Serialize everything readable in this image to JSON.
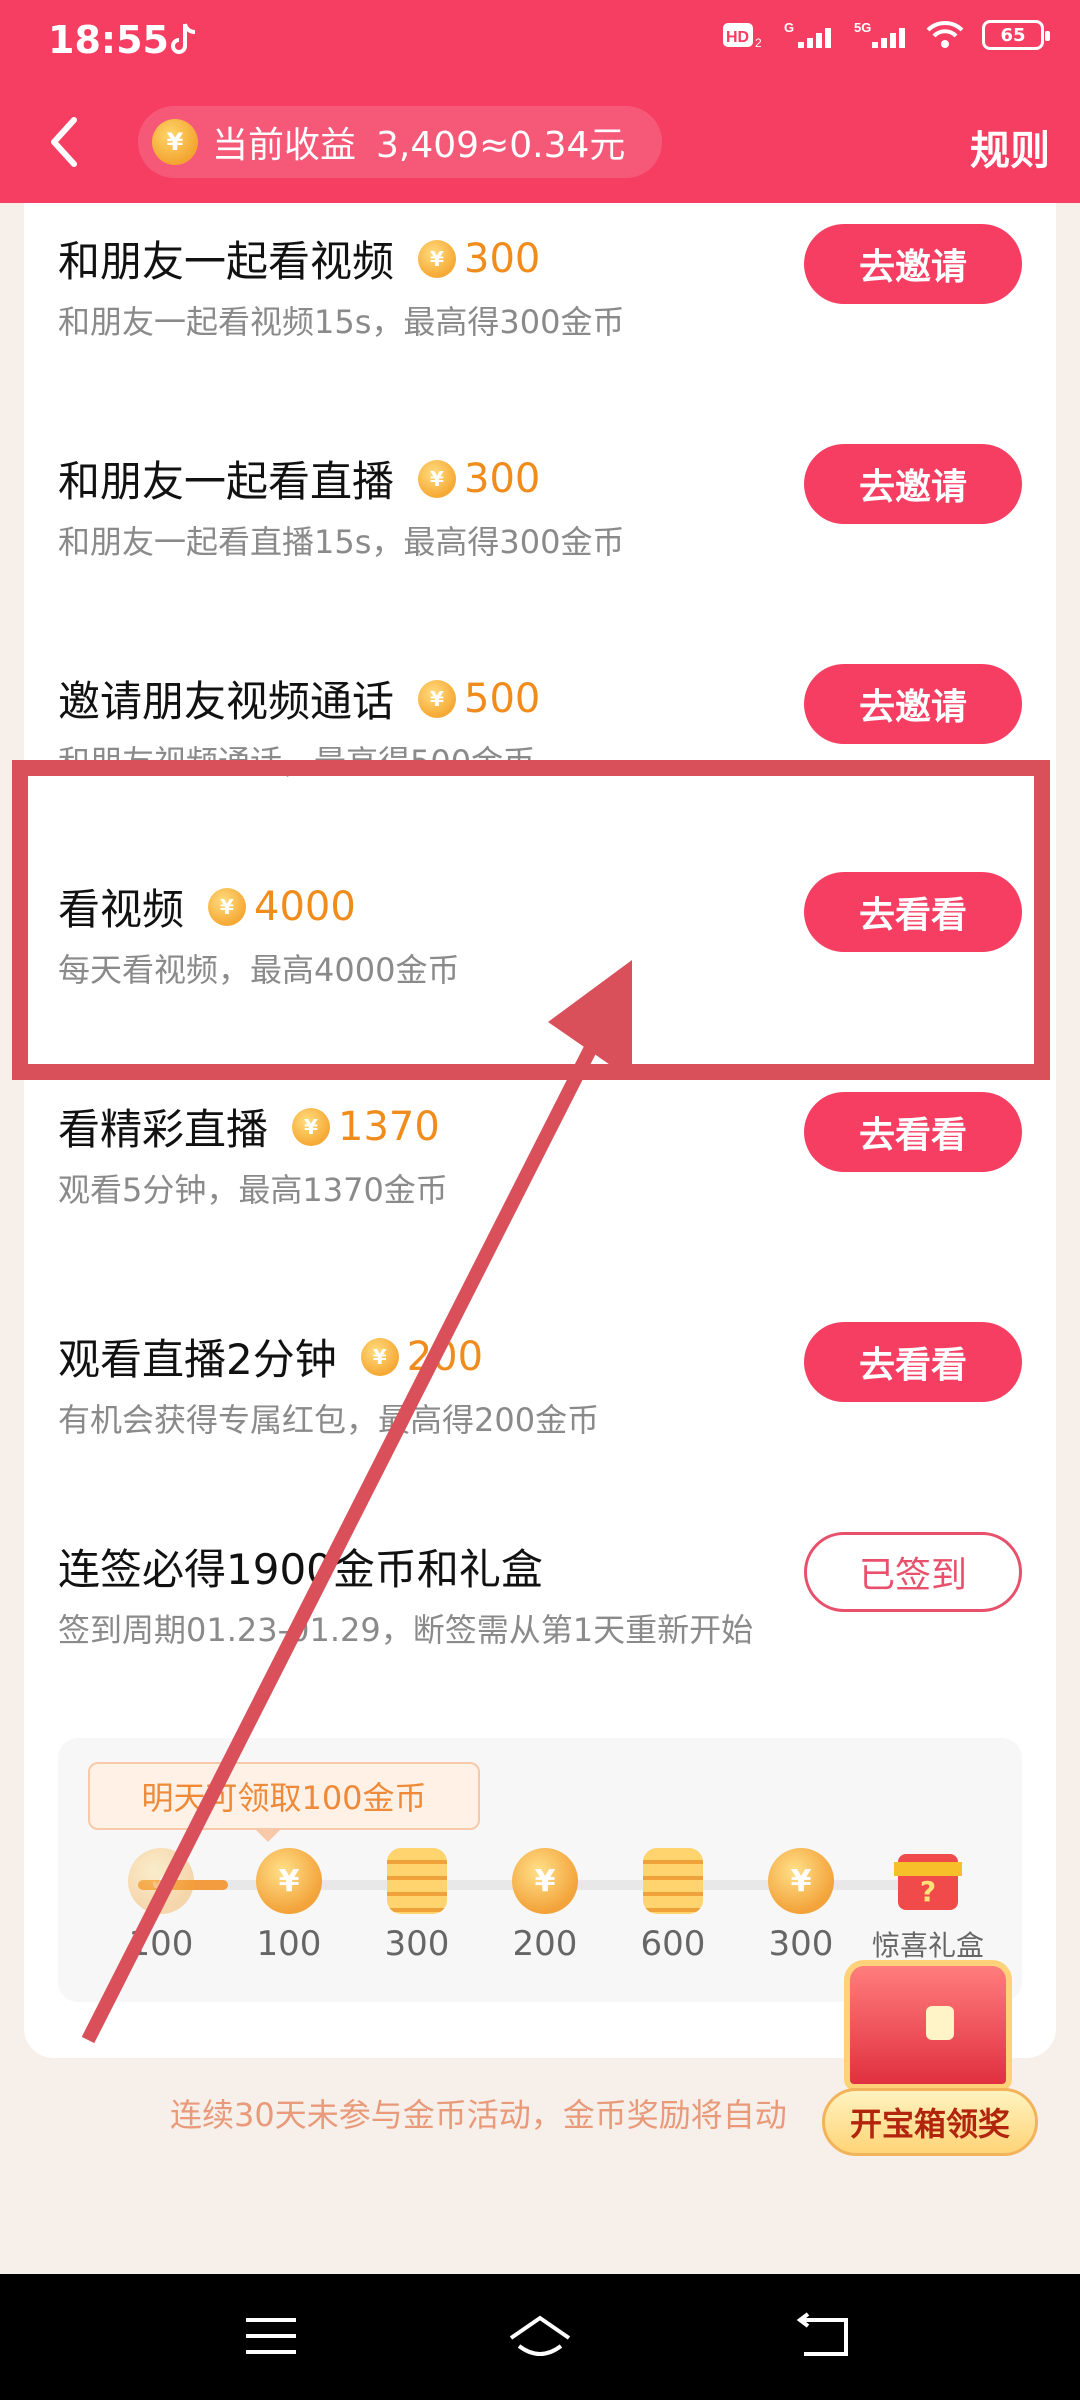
{
  "status_bar": {
    "time": "18:55",
    "battery": "65"
  },
  "header": {
    "earnings_label": "当前收益",
    "earnings_value": "3,409≈0.34元",
    "rules_label": "规则"
  },
  "tasks": [
    {
      "title": "和朋友一起看视频",
      "reward": "300",
      "desc": "和朋友一起看视频15s，最高得300金币",
      "button": "去邀请"
    },
    {
      "title": "和朋友一起看直播",
      "reward": "300",
      "desc": "和朋友一起看直播15s，最高得300金币",
      "button": "去邀请"
    },
    {
      "title": "邀请朋友视频通话",
      "reward": "500",
      "desc": "和朋友视频通话，最高得500金币",
      "button": "去邀请"
    },
    {
      "title": "看视频",
      "reward": "4000",
      "desc": "每天看视频，最高4000金币",
      "button": "去看看"
    },
    {
      "title": "看精彩直播",
      "reward": "1370",
      "desc": "观看5分钟，最高1370金币",
      "button": "去看看"
    },
    {
      "title": "观看直播2分钟",
      "reward": "200",
      "desc": "有机会获得专属红包，最高得200金币",
      "button": "去看看"
    }
  ],
  "signin": {
    "title": "连签必得1900金币和礼盒",
    "desc": "签到周期01.23-01.29，断签需从第1天重新开始",
    "button": "已签到",
    "tomorrow_tip": "明天可领取100金币",
    "days": [
      {
        "label": "100",
        "icon": "coin-icon",
        "done": true
      },
      {
        "label": "100",
        "icon": "coin-icon"
      },
      {
        "label": "300",
        "icon": "coin-stack-icon"
      },
      {
        "label": "200",
        "icon": "coin-icon"
      },
      {
        "label": "600",
        "icon": "coin-stack-icon"
      },
      {
        "label": "300",
        "icon": "coin-icon"
      },
      {
        "label": "惊喜礼盒",
        "icon": "gift-icon"
      }
    ]
  },
  "footer_note": "连续30天未参与金币活动，金币奖励将自动",
  "treasure_label": "开宝箱领奖",
  "colors": {
    "brand": "#f53e62",
    "coin": "#f08c1c",
    "annotation": "#d9505b"
  }
}
